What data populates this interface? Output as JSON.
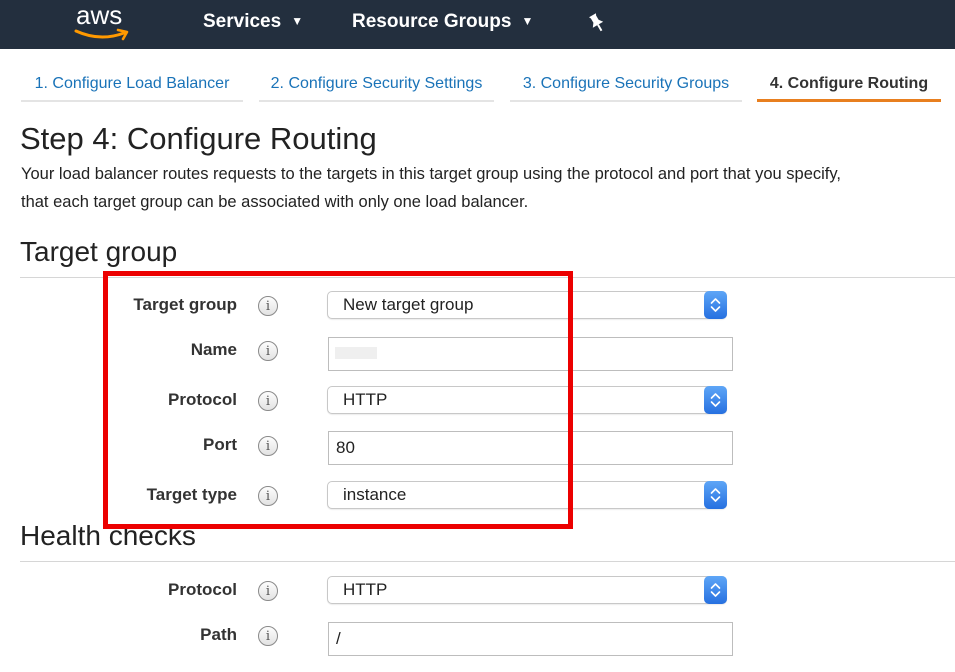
{
  "nav": {
    "logo": "aws",
    "services": "Services",
    "resource_groups": "Resource Groups",
    "chevron": "▼",
    "pin_icon": "pin-icon"
  },
  "tabs": [
    {
      "label": "1. Configure Load Balancer"
    },
    {
      "label": "2. Configure Security Settings"
    },
    {
      "label": "3. Configure Security Groups"
    },
    {
      "label": "4. Configure Routing",
      "active": true
    }
  ],
  "page": {
    "title": "Step 4: Configure Routing",
    "description_line1": "Your load balancer routes requests to the targets in this target group using the protocol and port that you specify,",
    "description_line2": "that each target group can be associated with only one load balancer."
  },
  "target_group": {
    "heading": "Target group",
    "fields": {
      "target_group": {
        "label": "Target group",
        "value": "New target group"
      },
      "name": {
        "label": "Name",
        "value": ""
      },
      "protocol": {
        "label": "Protocol",
        "value": "HTTP"
      },
      "port": {
        "label": "Port",
        "value": "80"
      },
      "target_type": {
        "label": "Target type",
        "value": "instance"
      }
    }
  },
  "health_checks": {
    "heading": "Health checks",
    "fields": {
      "protocol": {
        "label": "Protocol",
        "value": "HTTP"
      },
      "path": {
        "label": "Path",
        "value": "/"
      }
    }
  },
  "info_glyph": "i",
  "colors": {
    "nav_bg": "#232f3e",
    "link": "#1a73b8",
    "active_tab_accent": "#e87f1f",
    "highlight": "#ec0000",
    "stepper": "#2670e0"
  }
}
